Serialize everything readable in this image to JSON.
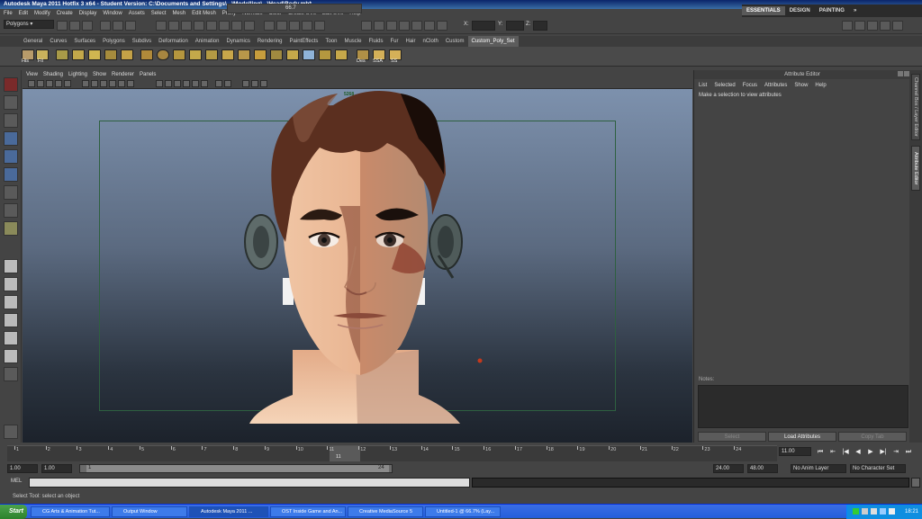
{
  "window": {
    "title": "Autodesk Maya 2011 Hotfix 3 x64 - Student Version: C:\\Documents and Settings\\...\\Modelling\\...\\Head\\Body.mb*"
  },
  "menubar": {
    "items": [
      "File",
      "Edit",
      "Modify",
      "Create",
      "Display",
      "Window",
      "Assets",
      "Select",
      "Mesh",
      "Edit Mesh",
      "Proxy",
      "Normals",
      "Color",
      "Create UVs",
      "Edit UVs",
      "Help"
    ]
  },
  "workspaces": {
    "items": [
      "ESSENTIALS",
      "DESIGN",
      "PAINTING"
    ],
    "active": "ESSENTIALS",
    "more": "»"
  },
  "statusline": {
    "mode": "Polygons",
    "zoom": "66.7",
    "x_label": "X:",
    "y_label": "Y:",
    "z_label": "Z:"
  },
  "shelf": {
    "tabs": [
      "General",
      "Curves",
      "Surfaces",
      "Polygons",
      "Subdivs",
      "Deformation",
      "Animation",
      "Dynamics",
      "Rendering",
      "PaintEffects",
      "Toon",
      "Muscle",
      "Fluids",
      "Fur",
      "Hair",
      "nCloth",
      "Custom",
      "Custom_Poly_Set"
    ],
    "active_tab": "Custom_Poly_Set",
    "labels": [
      "His",
      "Fil",
      "Des",
      "SSA",
      "SS"
    ]
  },
  "panel": {
    "menu": [
      "View",
      "Shading",
      "Lighting",
      "Show",
      "Renderer",
      "Panels"
    ],
    "hud": "5268"
  },
  "attribute_editor": {
    "title": "Attribute Editor",
    "menu": [
      "List",
      "Selected",
      "Focus",
      "Attributes",
      "Show",
      "Help"
    ],
    "hint": "Make a selection to view attributes",
    "notes_label": " Notes: ",
    "buttons": [
      "Select",
      "Load Attributes",
      "Copy Tab"
    ]
  },
  "side_tabs": [
    "Channel Box / Layer Editor",
    "Attribute Editor"
  ],
  "timeline": {
    "ticks": [
      "1",
      "2",
      "3",
      "4",
      "5",
      "6",
      "7",
      "8",
      "9",
      "10",
      "11",
      "12",
      "13",
      "14",
      "15",
      "16",
      "17",
      "18",
      "19",
      "20",
      "21",
      "22",
      "23",
      "24"
    ],
    "current_frame_marker": "11",
    "current_time": "11.00"
  },
  "playback": [
    "⏮",
    "⇤",
    "|◀",
    "◀",
    "▶",
    "▶|",
    "⇥",
    "⏭"
  ],
  "range": {
    "start": "1.00",
    "playback_start": "1.00",
    "range_start": "1",
    "range_end": "24",
    "playback_end": "24.00",
    "end": "48.00",
    "anim_layer": "No Anim Layer",
    "char_set": "No Character Set"
  },
  "mel": {
    "label": "MEL"
  },
  "helpline": {
    "text": "Select Tool: select an object"
  },
  "taskbar": {
    "start": "Start",
    "tasks": [
      "CG Arts & Animation Tut...",
      "Output Window",
      "Autodesk Maya 2011 ...",
      "OST Inside Game and An...",
      "Creative MediaSource 5",
      "Untitled-1 @ 66.7% (Lay..."
    ],
    "active_task": "Autodesk Maya 2011 ...",
    "clock": "18:21"
  }
}
